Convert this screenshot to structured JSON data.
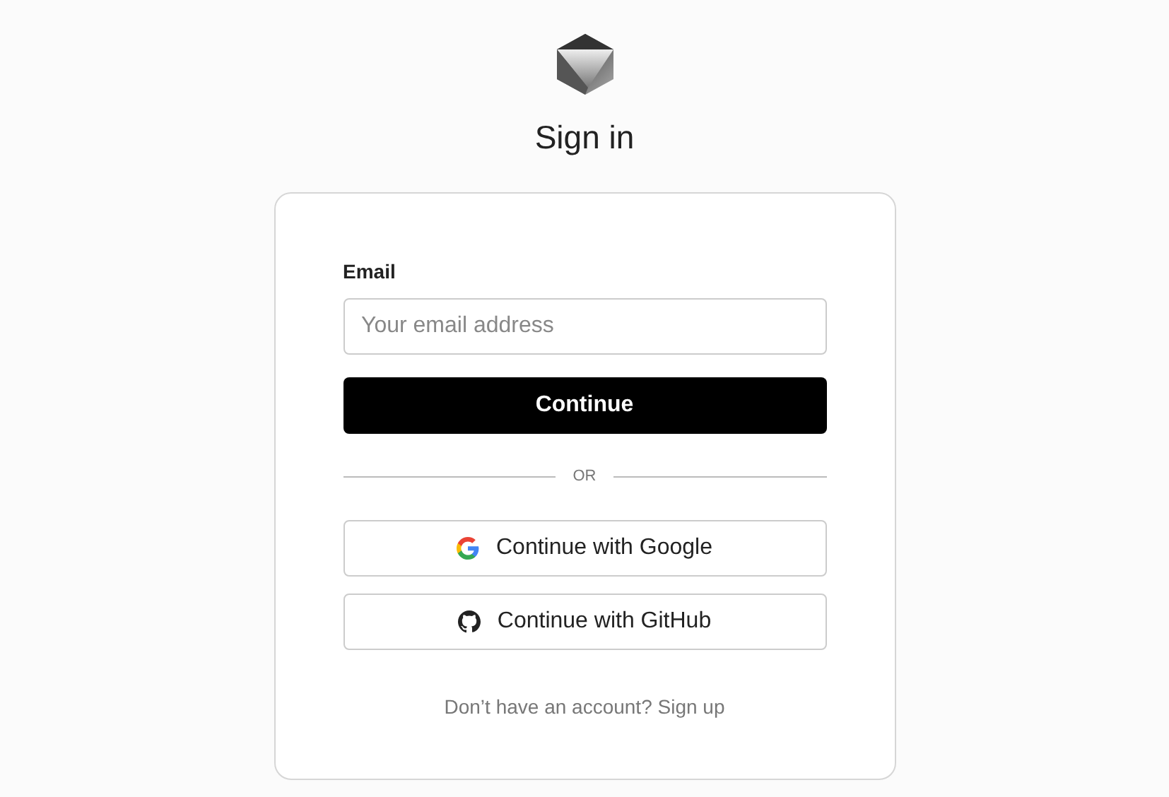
{
  "title": "Sign in",
  "email": {
    "label": "Email",
    "placeholder": "Your email address"
  },
  "submit": "Continue",
  "divider": "OR",
  "providers": [
    {
      "kind": "google",
      "label": "Continue with Google"
    },
    {
      "kind": "github",
      "label": "Continue with GitHub"
    }
  ],
  "footer": {
    "text": "Don’t have an account?",
    "link": "Sign up"
  }
}
